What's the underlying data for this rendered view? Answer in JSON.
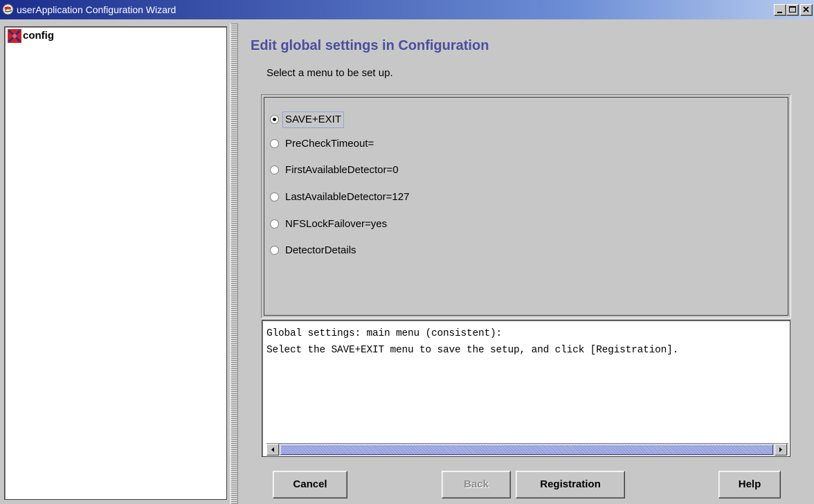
{
  "window": {
    "title": "userApplication Configuration Wizard",
    "icon": "app-globe-icon",
    "controls": [
      "minimize-icon",
      "maximize-icon",
      "close-icon"
    ]
  },
  "tree": {
    "root": {
      "label": "config",
      "icon": "config-node-icon",
      "icon_color": "#d42020"
    }
  },
  "main": {
    "title": "Edit global settings in Configuration",
    "title_color": "#4a4ea0",
    "instruction": "Select a menu to be set up.",
    "menu_options": [
      {
        "label": "SAVE+EXIT",
        "selected": true
      },
      {
        "label": "PreCheckTimeout=",
        "selected": false
      },
      {
        "label": "FirstAvailableDetector=0",
        "selected": false
      },
      {
        "label": "LastAvailableDetector=127",
        "selected": false
      },
      {
        "label": "NFSLockFailover=yes",
        "selected": false
      },
      {
        "label": "DetectorDetails",
        "selected": false
      }
    ],
    "message_lines": [
      "Global settings: main menu (consistent):",
      "Select the SAVE+EXIT menu to save the setup, and click [Registration]."
    ]
  },
  "buttons": {
    "cancel": "Cancel",
    "back": "Back",
    "registration": "Registration",
    "help": "Help"
  }
}
